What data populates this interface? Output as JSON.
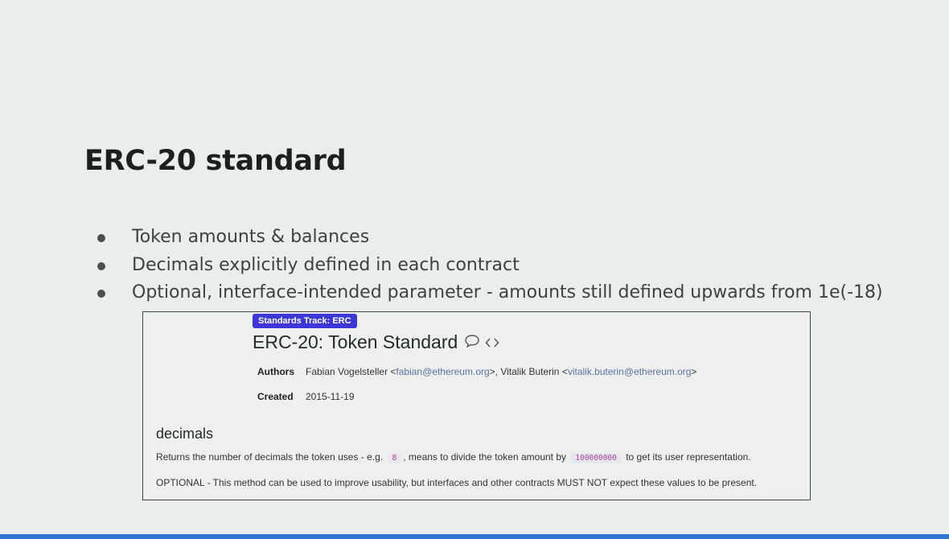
{
  "slide": {
    "title": "ERC-20 standard",
    "bullets": [
      "Token amounts & balances",
      "Decimals explicitly defined in each contract",
      "Optional, interface-intended parameter - amounts still defined upwards from 1e(-18)"
    ]
  },
  "eip": {
    "badge": "Standards Track: ERC",
    "title": "ERC-20: Token Standard",
    "authors_label": "Authors",
    "author1_name": "Fabian Vogelsteller <",
    "author1_email": "fabian@ethereum.org",
    "author_sep": ">, Vitalik Buterin <",
    "author2_email": "vitalik.buterin@ethereum.org",
    "author_end": ">",
    "created_label": "Created",
    "created_value": "2015-11-19",
    "section_heading": "decimals",
    "para1_before": "Returns the number of decimals the token uses - e.g.",
    "para1_code1": "8",
    "para1_middle": ", means to divide the token amount by",
    "para1_code2": "100000000",
    "para1_after": "to get its user representation.",
    "para2": "OPTIONAL - This method can be used to improve usability, but interfaces and other contracts MUST NOT expect these values to be present."
  },
  "icons": {
    "comment": "comment-icon",
    "code": "code-icon"
  },
  "colors": {
    "badge": "#3d36d8",
    "link": "#5b6fa3",
    "code": "#a73fa0",
    "accent_bar": "#2f76d0"
  }
}
